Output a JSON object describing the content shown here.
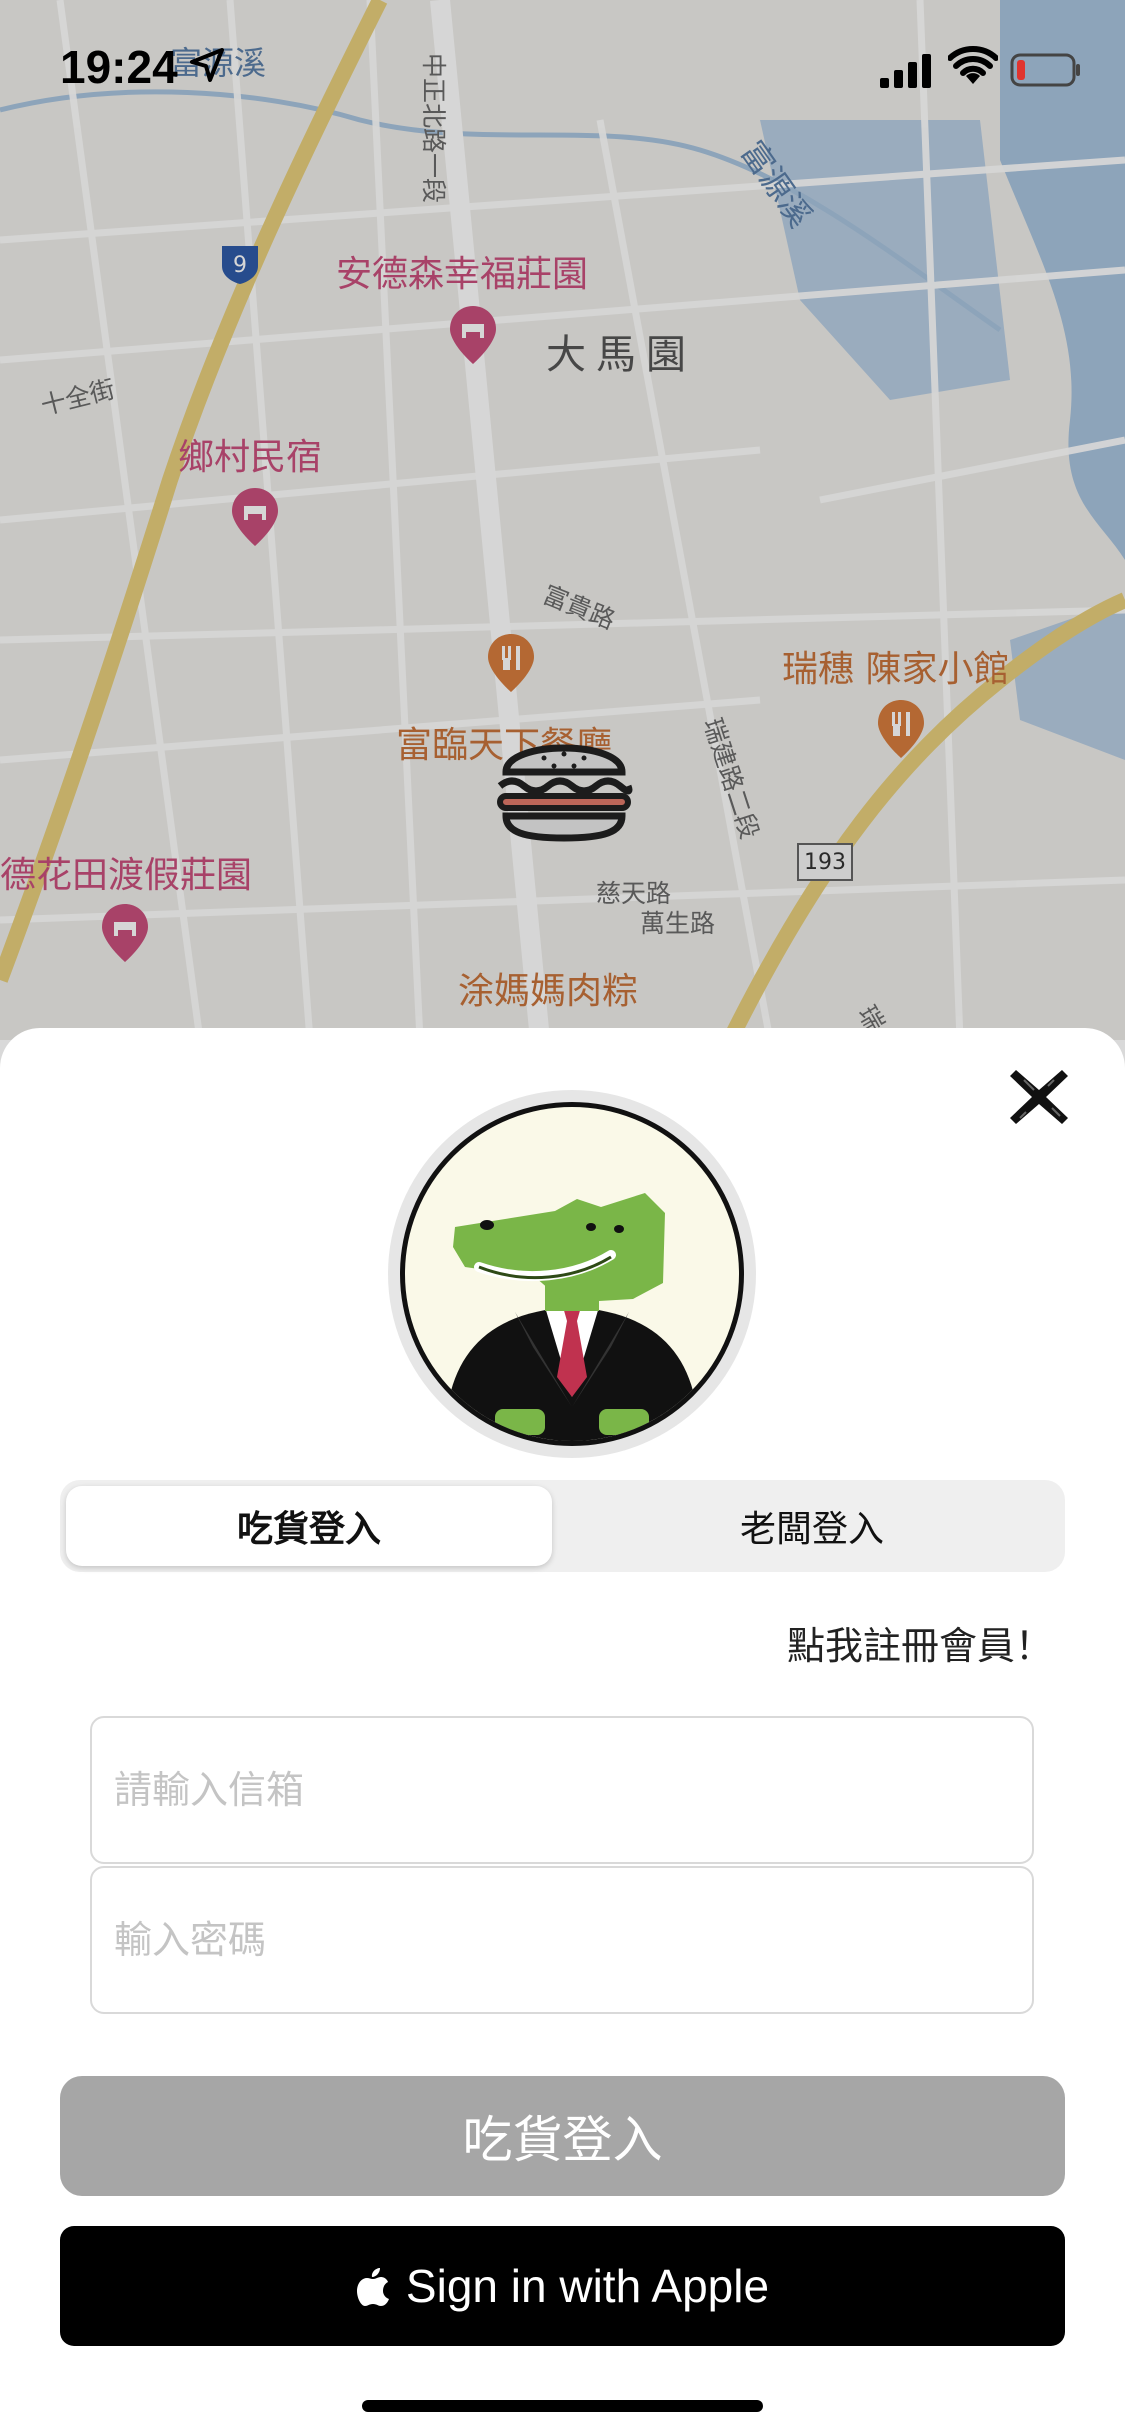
{
  "status": {
    "time": "19:24"
  },
  "map": {
    "labels": {
      "stream_top": "富源溪",
      "stream_right": "富源溪",
      "road_zhongzheng": "中正北路一段",
      "poi_andesen": "安德森幸福莊園",
      "area_damayuan": "大馬園",
      "road_shiquan": "十全街",
      "poi_xiangcun": "鄉村民宿",
      "road_fugui": "富貴路",
      "food_ruisui": "瑞穗 陳家小館",
      "road_ruijian": "瑞建路二段",
      "food_fulin": "富臨天下餐廳",
      "poi_huatian": "德花田渡假莊園",
      "road_citian": "慈天路",
      "road_wansheng": "萬生路",
      "food_tuma": "涂媽媽肉粽",
      "road_rui": "瑞",
      "route_9": "9",
      "route_193": "193"
    }
  },
  "login": {
    "tabs": [
      "吃貨登入",
      "老闆登入"
    ],
    "register_link": "點我註冊會員！",
    "email_placeholder": "請輸入信箱",
    "password_placeholder": "輸入密碼",
    "login_button": "吃貨登入",
    "apple_button": "Sign in with Apple"
  },
  "colors": {
    "accent_pink": "#c94f7c",
    "accent_orange": "#c7733b",
    "crocodile_green": "#7ab648",
    "tie_red": "#c0324f"
  }
}
